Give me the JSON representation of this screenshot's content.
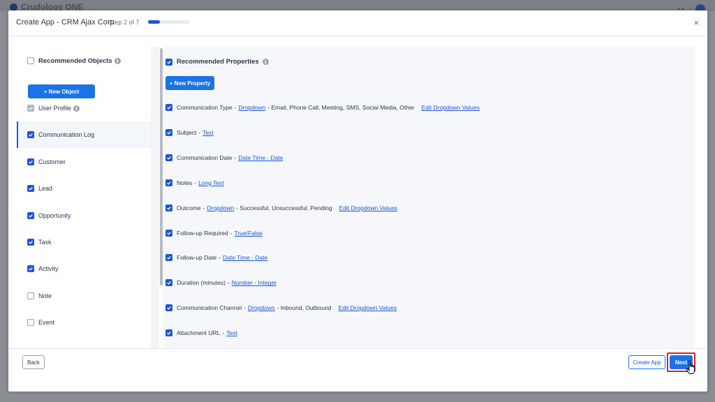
{
  "background": {
    "brand_text": "Crudology ONE"
  },
  "modal": {
    "title": "Create App  - CRM Ajax Corp",
    "step_text": "Step 2 of 7",
    "step_progress": 0.2857,
    "close_label": "×"
  },
  "sidebar": {
    "header": {
      "label": "Recommended Objects",
      "checked": false
    },
    "new_object_label": "+ New Object",
    "items": [
      {
        "label": "User Profile",
        "state": "disabled",
        "info": true
      },
      {
        "label": "Communication Log",
        "state": "checked",
        "active": true
      },
      {
        "label": "Customer",
        "state": "checked"
      },
      {
        "label": "Lead",
        "state": "checked"
      },
      {
        "label": "Opportunity",
        "state": "checked"
      },
      {
        "label": "Task",
        "state": "checked"
      },
      {
        "label": "Activity",
        "state": "checked"
      },
      {
        "label": "Note",
        "state": "unchecked"
      },
      {
        "label": "Event",
        "state": "unchecked"
      }
    ]
  },
  "properties": {
    "header": {
      "label": "Recommended Properties",
      "checked": true
    },
    "new_property_label": "+ New Property",
    "rows": [
      {
        "name": "Communication Type",
        "type": "Dropdown",
        "options": "- Email, Phone Call, Meeting, SMS, Social Media, Other",
        "edit": "Edit Dropdown Values"
      },
      {
        "name": "Subject",
        "type": "Text"
      },
      {
        "name": "Communication Date",
        "type": "Date Time - Date"
      },
      {
        "name": "Notes",
        "type": "Long Text"
      },
      {
        "name": "Outcome",
        "type": "Dropdown",
        "options": "- Successful, Unsuccessful, Pending",
        "edit": "Edit Dropdown Values"
      },
      {
        "name": "Follow-up Required",
        "type": "True/False"
      },
      {
        "name": "Follow-up Date",
        "type": "Date Time - Date"
      },
      {
        "name": "Duration (minutes)",
        "type": "Number - Integer"
      },
      {
        "name": "Communication Channel",
        "type": "Dropdown",
        "options": "- Inbound, Outbound",
        "edit": "Edit Dropdown Values"
      },
      {
        "name": "Attachment URL",
        "type": "Text"
      }
    ],
    "separator": "-"
  },
  "footer": {
    "back_label": "Back",
    "create_app_label": "Create App",
    "next_label": "Next"
  },
  "colors": {
    "primary": "#1a73e8",
    "link": "#1a56db",
    "highlight": "#e11d2a"
  }
}
